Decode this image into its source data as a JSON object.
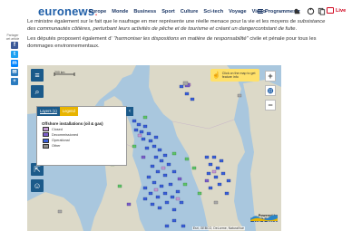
{
  "header": {
    "logo_main": "euronews",
    "logo_dot": ".",
    "nav": [
      "Europe",
      "Monde",
      "Business",
      "Sport",
      "Culture",
      "Sci-tech",
      "Voyage",
      "Vidéo"
    ],
    "programmes": "Programmes ▾",
    "live": "Live"
  },
  "share": {
    "label": "Partager cet article",
    "items": [
      {
        "name": "facebook",
        "glyph": "f",
        "color": "#3b5998"
      },
      {
        "name": "twitter",
        "glyph": "t",
        "color": "#1da1f2"
      },
      {
        "name": "messenger",
        "glyph": "m",
        "color": "#0084ff"
      },
      {
        "name": "email",
        "glyph": "✉",
        "color": "#2a7bbf"
      },
      {
        "name": "more",
        "glyph": "+",
        "color": "#2a7bbf"
      }
    ]
  },
  "article": {
    "para1_start": "Le ministre également sur le fait que le naufrage en mer représente une réelle menace pour la vie et les moyens de ",
    "para1_italic": "subsistance des communautés côtières, perturbant leurs activités de pêche et de tourisme et créant un dangercontstant de fuite",
    "para1_end": ".",
    "para2_start": "Les députés proposent également d' ",
    "para2_italic": "\"harmoniser les dispositions en matière de responsabilité\"",
    "para2_end": " civile et pénale pour tous les dommages environnementaux."
  },
  "map": {
    "scale": "200 km",
    "click_tip": "Click on the map to get feature info",
    "legend": {
      "tabs": [
        "Layers (1)",
        "Legend"
      ],
      "title": "Offshore installations (oil & gas)",
      "items": [
        {
          "label": "Closed",
          "color": "#c39bd3"
        },
        {
          "label": "Decommissioned",
          "color": "#7b5fc9"
        },
        {
          "label": "Operational",
          "color": "#3a5fd8"
        },
        {
          "label": "Other",
          "color": "#8e8e8e"
        }
      ]
    },
    "powered_by": "Powered by",
    "brand": "EMODnet",
    "attribution": "Esri, GEBCO, DeLorme, NaturalVue"
  }
}
